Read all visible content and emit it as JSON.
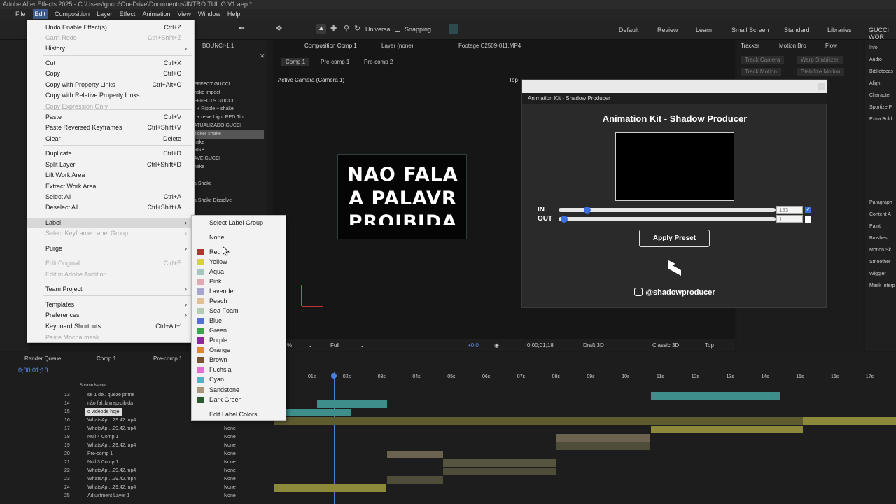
{
  "title_bar": "Adobe After Effects 2025 - C:\\Users\\gucci\\OneDrive\\Documentos\\INTRO TULIO V1.aep *",
  "menu": [
    "File",
    "Edit",
    "Composition",
    "Layer",
    "Effect",
    "Animation",
    "View",
    "Window",
    "Help"
  ],
  "toolbar": {
    "universal": "Universal",
    "snapping": "Snapping"
  },
  "workspaces": [
    "Default",
    "Review",
    "Learn",
    "Small Screen",
    "Standard",
    "Libraries",
    "GUCCI WOR"
  ],
  "edit_menu": [
    {
      "label": "Undo Enable Effect(s)",
      "shortcut": "Ctrl+Z",
      "disabled": false
    },
    {
      "label": "Can't Redo",
      "shortcut": "Ctrl+Shift+Z",
      "disabled": true
    },
    {
      "label": "History",
      "shortcut": "",
      "disabled": false,
      "submenu": true
    },
    {
      "label": "Cut",
      "shortcut": "Ctrl+X",
      "disabled": false
    },
    {
      "label": "Copy",
      "shortcut": "Ctrl+C",
      "disabled": false
    },
    {
      "label": "Copy with Property Links",
      "shortcut": "Ctrl+Alt+C",
      "disabled": false
    },
    {
      "label": "Copy with Relative Property Links",
      "shortcut": "",
      "disabled": false
    },
    {
      "label": "Copy Expression Only",
      "shortcut": "",
      "disabled": true
    },
    {
      "label": "Paste",
      "shortcut": "Ctrl+V",
      "disabled": false
    },
    {
      "label": "Paste Reversed Keyframes",
      "shortcut": "Ctrl+Shift+V",
      "disabled": false
    },
    {
      "label": "Clear",
      "shortcut": "Delete",
      "disabled": false
    },
    {
      "label": "Duplicate",
      "shortcut": "Ctrl+D",
      "disabled": false
    },
    {
      "label": "Split Layer",
      "shortcut": "Ctrl+Shift+D",
      "disabled": false
    },
    {
      "label": "Lift Work Area",
      "shortcut": "",
      "disabled": false
    },
    {
      "label": "Extract Work Area",
      "shortcut": "",
      "disabled": false
    },
    {
      "label": "Select All",
      "shortcut": "Ctrl+A",
      "disabled": false
    },
    {
      "label": "Deselect All",
      "shortcut": "Ctrl+Shift+A",
      "disabled": false
    },
    {
      "label": "Label",
      "shortcut": "",
      "disabled": false,
      "submenu": true
    },
    {
      "label": "Select Keyframe Label Group",
      "shortcut": "",
      "disabled": true,
      "submenu": true
    },
    {
      "label": "Purge",
      "shortcut": "",
      "disabled": false,
      "submenu": true
    },
    {
      "label": "Edit Original...",
      "shortcut": "Ctrl+E",
      "disabled": true
    },
    {
      "label": "Edit in Adobe Audition",
      "shortcut": "",
      "disabled": true
    },
    {
      "label": "Team Project",
      "shortcut": "",
      "disabled": false,
      "submenu": true
    },
    {
      "label": "Templates",
      "shortcut": "",
      "disabled": false,
      "submenu": true
    },
    {
      "label": "Preferences",
      "shortcut": "",
      "disabled": false,
      "submenu": true
    },
    {
      "label": "Keyboard Shortcuts",
      "shortcut": "Ctrl+Alt+'",
      "disabled": false
    },
    {
      "label": "Paste Mocha mask",
      "shortcut": "",
      "disabled": true
    }
  ],
  "label_submenu": {
    "header": "Select Label Group",
    "none": "None",
    "colors": [
      {
        "label": "Red",
        "color": "#b83232"
      },
      {
        "label": "Yellow",
        "color": "#d6d23c"
      },
      {
        "label": "Aqua",
        "color": "#a7c6c2"
      },
      {
        "label": "Pink",
        "color": "#e0a9b4"
      },
      {
        "label": "Lavender",
        "color": "#a8a6cf"
      },
      {
        "label": "Peach",
        "color": "#e1bf97"
      },
      {
        "label": "Sea Foam",
        "color": "#b3cdb4"
      },
      {
        "label": "Blue",
        "color": "#5371d6"
      },
      {
        "label": "Green",
        "color": "#3aa54a"
      },
      {
        "label": "Purple",
        "color": "#8b2b9b"
      },
      {
        "label": "Orange",
        "color": "#e08a2e"
      },
      {
        "label": "Brown",
        "color": "#7d5432"
      },
      {
        "label": "Fuchsia",
        "color": "#e36ed6"
      },
      {
        "label": "Cyan",
        "color": "#4fb4c6"
      },
      {
        "label": "Sandstone",
        "color": "#a89479"
      },
      {
        "label": "Dark Green",
        "color": "#2b5a32"
      }
    ],
    "edit": "Edit Label Colors..."
  },
  "effects_panel": {
    "tab": "BOUNCr-1.1",
    "items": [
      "EFFECT GUCCI",
      "hake impect",
      "EFFECTS GUCCI",
      "r + Ripple + shake",
      "r + reive Light RED Tint",
      "ATUALIZADO GUCCI",
      "flicker shake",
      "hake",
      "RGB",
      "AVE GUCCI",
      "hake",
      "a Shake",
      "a Shake Dissolve"
    ]
  },
  "composition": {
    "tab": "Composition Comp 1",
    "layer_tab": "Layer (none)",
    "footage_tab": "Footage C2509-011.MP4",
    "breadcrumbs": [
      "Comp 1",
      "Pre-comp 1",
      "Pre-comp 2"
    ],
    "camera": "Active Camera (Camera 1)",
    "top_label": "Top",
    "preview_text": [
      "NAO FALA",
      "A PALAVR",
      "PROIBIDA"
    ],
    "footer": {
      "zoom": "%",
      "resolution": "Full",
      "exposure": "+0.0",
      "timecode": "0;00;01;18",
      "draft": "Draft 3D",
      "renderer": "Classic 3D",
      "view": "Top"
    }
  },
  "kit": {
    "header": "Animation Kit - Shadow Producer",
    "title": "Animation Kit - Shadow Producer",
    "in_label": "IN",
    "out_label": "OUT",
    "in_value": "133",
    "out_value": "1",
    "in_level": 0.07,
    "out_level": 0.01,
    "apply": "Apply Preset",
    "instagram": "@shadowproducer"
  },
  "right_panel": {
    "tabs": [
      "Tracker",
      "Motion Bro",
      "Flow"
    ],
    "buttons": [
      "Track Camera",
      "Warp Stabilizer",
      "Track Motion",
      "Stabilize Motion"
    ]
  },
  "info_panel": [
    "Info",
    "Audio",
    "Bibliotecas",
    "Align",
    "Character",
    "Sportize P",
    "Extra Bold",
    "Paragraph",
    "Content A",
    "Paint",
    "Brushes",
    "Motion Sk",
    "Smoother",
    "Wiggler",
    "Mask Interp"
  ],
  "timeline": {
    "tabs": [
      "Render Queue",
      "Comp 1",
      "Pre-comp 1"
    ],
    "timecode": "0;00;01;18",
    "source_name_header": "Source Name",
    "ruler": [
      "01s",
      "02s",
      "03s",
      "04s",
      "05s",
      "06s",
      "07s",
      "08s",
      "09s",
      "10s",
      "11s",
      "12s",
      "13s",
      "14s",
      "15s",
      "16s",
      "17s"
    ],
    "layers": [
      {
        "num": "13",
        "name": "se 1 de.. quezé prime",
        "parent": ""
      },
      {
        "num": "14",
        "name": "não fal..lavraproibida",
        "parent": ""
      },
      {
        "num": "15",
        "name": "o videode hoje",
        "parent": ""
      },
      {
        "num": "16",
        "name": "WhatsAp....29.42.mp4",
        "parent": "None"
      },
      {
        "num": "17",
        "name": "WhatsAp....29.42.mp4",
        "parent": "None"
      },
      {
        "num": "18",
        "name": "Null 4 Comp 1",
        "parent": "None"
      },
      {
        "num": "19",
        "name": "WhatsAp....29.42.mp4",
        "parent": "None"
      },
      {
        "num": "20",
        "name": "Pre-comp 1",
        "parent": "None"
      },
      {
        "num": "21",
        "name": "Null 3 Comp 1",
        "parent": "None"
      },
      {
        "num": "22",
        "name": "WhatsAp....29.42.mp4",
        "parent": "None"
      },
      {
        "num": "23",
        "name": "WhatsAp....29.42.mp4",
        "parent": "None"
      },
      {
        "num": "24",
        "name": "WhatsAp....29.42.mp4",
        "parent": "None"
      },
      {
        "num": "25",
        "name": "Adjustment Layer 1",
        "parent": "None"
      }
    ]
  },
  "colors": {
    "accent": "#3b6fe0",
    "menu_bg": "#f2f2f2",
    "teal_bar": "#3e8f8c",
    "olive_bar": "#8c8a3a"
  }
}
